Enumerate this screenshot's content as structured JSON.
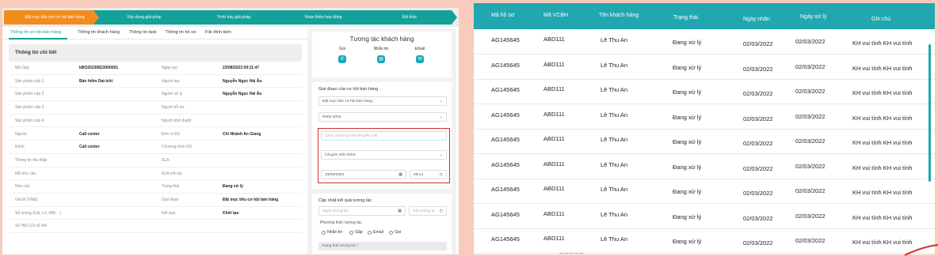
{
  "stepper": [
    {
      "label": "Đặt mục tiêu cho cơ hội bán hàng",
      "state": "active"
    },
    {
      "label": "Xây dựng giải pháp",
      "state": "todo"
    },
    {
      "label": "Trình bày giải pháp",
      "state": "todo"
    },
    {
      "label": "Hoàn thiện hợp đồng",
      "state": "todo"
    },
    {
      "label": "Kết thúc",
      "state": "todo"
    }
  ],
  "tabs": [
    {
      "label": "Thông tin cơ hội bán hàng",
      "active": true
    },
    {
      "label": "Thông tin khách hàng",
      "active": false
    },
    {
      "label": "Thông tin task",
      "active": false
    },
    {
      "label": "Thông tin hồ sơ",
      "active": false
    },
    {
      "label": "File đính kèm",
      "active": false
    }
  ],
  "details": {
    "title": "Thông tin chi tiết",
    "rows": [
      {
        "label": "Mã Opp",
        "value": "kBO20230823000001",
        "label2": "Ngày tạo",
        "value2": "23/08/2023 09:11:47"
      },
      {
        "label": "Sản phẩm cấp 1",
        "value": "Bảo hiểm Dai-ichi",
        "label2": "Người tạo",
        "value2": "Nguyễn Ngọc Hải Âu"
      },
      {
        "label": "Sản phẩm cấp 2",
        "value": "",
        "label2": "Người xử lý",
        "value2": "Nguyễn Ngọc Hải Âu"
      },
      {
        "label": "Sản phẩm cấp 3",
        "value": "",
        "label2": "Người hỗ trợ",
        "value2": ""
      },
      {
        "label": "Sản phẩm cấp 4",
        "value": "",
        "label2": "Người phê duyệt",
        "value2": ""
      },
      {
        "label": "Nguồn",
        "value": "Call center",
        "label2": "Đơn vị ED",
        "value2": "Chi Nhánh An Giang"
      },
      {
        "label": "Kênh",
        "value": "Call center",
        "label2": "Chương trình KD",
        "value2": ""
      },
      {
        "label": "Thông tin thu thập",
        "value": "",
        "label2": "SLA",
        "value2": ""
      },
      {
        "label": "Mã nhu cầu",
        "value": "",
        "label2": "SLA còn lại",
        "value2": ""
      },
      {
        "label": "Nhu cầu",
        "value": "",
        "label2": "Trạng thái",
        "value2": "Đang xử lý"
      },
      {
        "label": "Giá trị (VNĐ)",
        "value": "",
        "label2": "Giai đoạn",
        "value2": "Đặt mục tiêu cơ hội bán hàng"
      },
      {
        "label": "Số lượng (Cái, Lô, MM,...)",
        "value": "",
        "label2": "Kết quả",
        "value2": "Khởi tạo"
      },
      {
        "label": "Số HĐ/ LD/ số thẻ",
        "value": "",
        "label2": "",
        "value2": ""
      }
    ]
  },
  "interaction": {
    "title": "Tương tác khách hàng",
    "channels": [
      {
        "label": "Gọi",
        "icon": "phone-icon"
      },
      {
        "label": "Nhắn tin",
        "icon": "chat-icon"
      },
      {
        "label": "Email",
        "icon": "email-icon"
      }
    ]
  },
  "stage_form": {
    "title": "Giai đoạn của cơ hội bán hàng",
    "stage_value": "Đặt mục tiêu cơ hội bán hàng",
    "referral_value": "Refer ID/IS",
    "promo_placeholder": "Chọn chương trình khuyến mãi",
    "advisor_value": "Chuyên viên ID/IS",
    "date_value": "23/08/2023",
    "time_value": "09:14"
  },
  "result_form": {
    "title": "Cập nhật kết quả tương tác",
    "date_placeholder": "Ngày tương tác",
    "time_placeholder": "Giờ tương tá",
    "method_label": "Phương thức tương tác",
    "methods": [
      "Nhắn tin",
      "Gặp",
      "Email",
      "Gọi"
    ],
    "status_placeholder": "Trạng thái tương tác *"
  },
  "table": {
    "headers": [
      "Mã hồ sơ",
      "Mã VCBH",
      "Tên khách hàng",
      "Trạng thái",
      "Ngày nhận",
      "Ngày xử lý",
      "Ghi chú"
    ],
    "rows": [
      [
        "AG145645",
        "ABD111",
        "Lê Thu An",
        "Đang xử lý",
        "02/03/2022",
        "02/03/2022",
        "KH vui tính KH vui tính"
      ],
      [
        "AG145645",
        "ABD111",
        "Lê Thu An",
        "Đang xử lý",
        "02/03/2022",
        "02/03/2022",
        "KH vui tính KH vui tính"
      ],
      [
        "AG145645",
        "ABD111",
        "Lê Thu An",
        "Đang xử lý",
        "02/03/2022",
        "02/03/2022",
        "KH vui tính KH vui tính"
      ],
      [
        "AG145645",
        "ABD111",
        "Lê Thu An",
        "Đang xử lý",
        "02/03/2022",
        "02/03/2022",
        "KH vui tính KH vui tính"
      ],
      [
        "AG145645",
        "ABD111",
        "Lê Thu An",
        "Đang xử lý",
        "02/03/2022",
        "02/03/2022",
        "KH vui tính KH vui tính"
      ],
      [
        "AG145645",
        "ABD111",
        "Lê Thu An",
        "Đang xử lý",
        "02/03/2022",
        "02/03/2022",
        "KH vui tính KH vui tính"
      ],
      [
        "AG145645",
        "ABD111",
        "Lê Thu An",
        "Đang xử lý",
        "02/03/2022",
        "02/03/2022",
        "KH vui tính KH vui tính"
      ],
      [
        "AG145645",
        "ABD111",
        "Lê Thu An",
        "Đang xử lý",
        "02/03/2022",
        "02/03/2022",
        "KH vui tính KH vui tính"
      ],
      [
        "AG145645",
        "ABD111",
        "Lê Thu An",
        "Đang xử lý",
        "02/03/2022",
        "02/03/2022",
        "KH vui tính KH vui tính"
      ]
    ]
  },
  "colors": {
    "active_step": "#f28c1e",
    "teal": "#13a19a",
    "table_header": "#22a7b1",
    "highlight_border": "#d62b2b",
    "background": "#f8cbbd"
  }
}
